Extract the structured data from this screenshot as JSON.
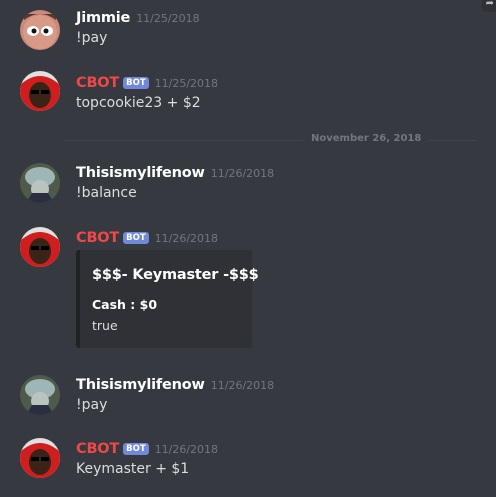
{
  "corner_icon": "reply-arrow-icon",
  "colors": {
    "bot_name": "#f04747",
    "user_name": "#ffffff",
    "bot_badge": "#7289da"
  },
  "messages": [
    {
      "author": "Jimmie",
      "timestamp": "11/25/2018",
      "text": "!pay",
      "avatar": "jimmie-avatar"
    },
    {
      "author": "CBOT",
      "badge": "BOT",
      "timestamp": "11/25/2018",
      "text": "topcookie23 + $2",
      "avatar": "cbot-avatar"
    },
    {
      "author": "Thisismylifenow",
      "timestamp": "11/26/2018",
      "text": "!balance",
      "avatar": "thisismylifenow-avatar"
    },
    {
      "author": "CBOT",
      "badge": "BOT",
      "timestamp": "11/26/2018",
      "avatar": "cbot-avatar",
      "embed": {
        "title": "$$$- Keymaster -$$$",
        "field_name": "Cash : $0",
        "field_value": "true"
      }
    },
    {
      "author": "Thisismylifenow",
      "timestamp": "11/26/2018",
      "text": "!pay",
      "avatar": "thisismylifenow-avatar"
    },
    {
      "author": "CBOT",
      "badge": "BOT",
      "timestamp": "11/26/2018",
      "text": "Keymaster + $1",
      "avatar": "cbot-avatar"
    }
  ],
  "date_divider": "November 26, 2018"
}
